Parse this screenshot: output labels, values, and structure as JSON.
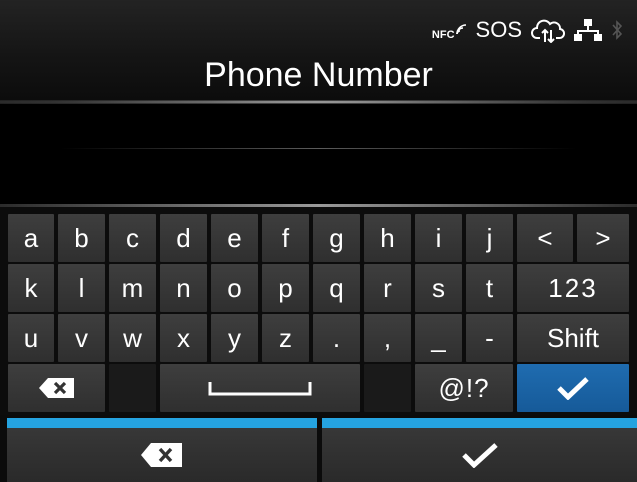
{
  "status_bar": {
    "nfc_label": "NFC",
    "sos_label": "SOS",
    "icons": [
      "nfc-icon",
      "cloud-sync-icon",
      "network-icon",
      "bluetooth-icon"
    ]
  },
  "header": {
    "title": "Phone Number"
  },
  "input": {
    "value": ""
  },
  "keyboard": {
    "rows": [
      [
        "a",
        "b",
        "c",
        "d",
        "e",
        "f",
        "g",
        "h",
        "i",
        "j",
        "<",
        ">"
      ],
      [
        "k",
        "l",
        "m",
        "n",
        "o",
        "p",
        "q",
        "r",
        "s",
        "t",
        "123"
      ],
      [
        "u",
        "v",
        "w",
        "x",
        "y",
        "z",
        ".",
        ",",
        "_",
        "-",
        "Shift"
      ],
      [
        "backspace",
        "",
        "space",
        "",
        "@!?",
        "enter"
      ]
    ],
    "left_label": "<",
    "right_label": ">",
    "numeric_label": "123",
    "shift_label": "Shift",
    "symbols_label": "@!?"
  },
  "bottom_bar": {
    "delete_icon": "backspace-icon",
    "confirm_icon": "checkmark-icon"
  },
  "colors": {
    "enter_key": "#1f6cb0",
    "accent_bar": "#25a3e0",
    "key_face": "#363636",
    "background": "#0b0b0b"
  }
}
